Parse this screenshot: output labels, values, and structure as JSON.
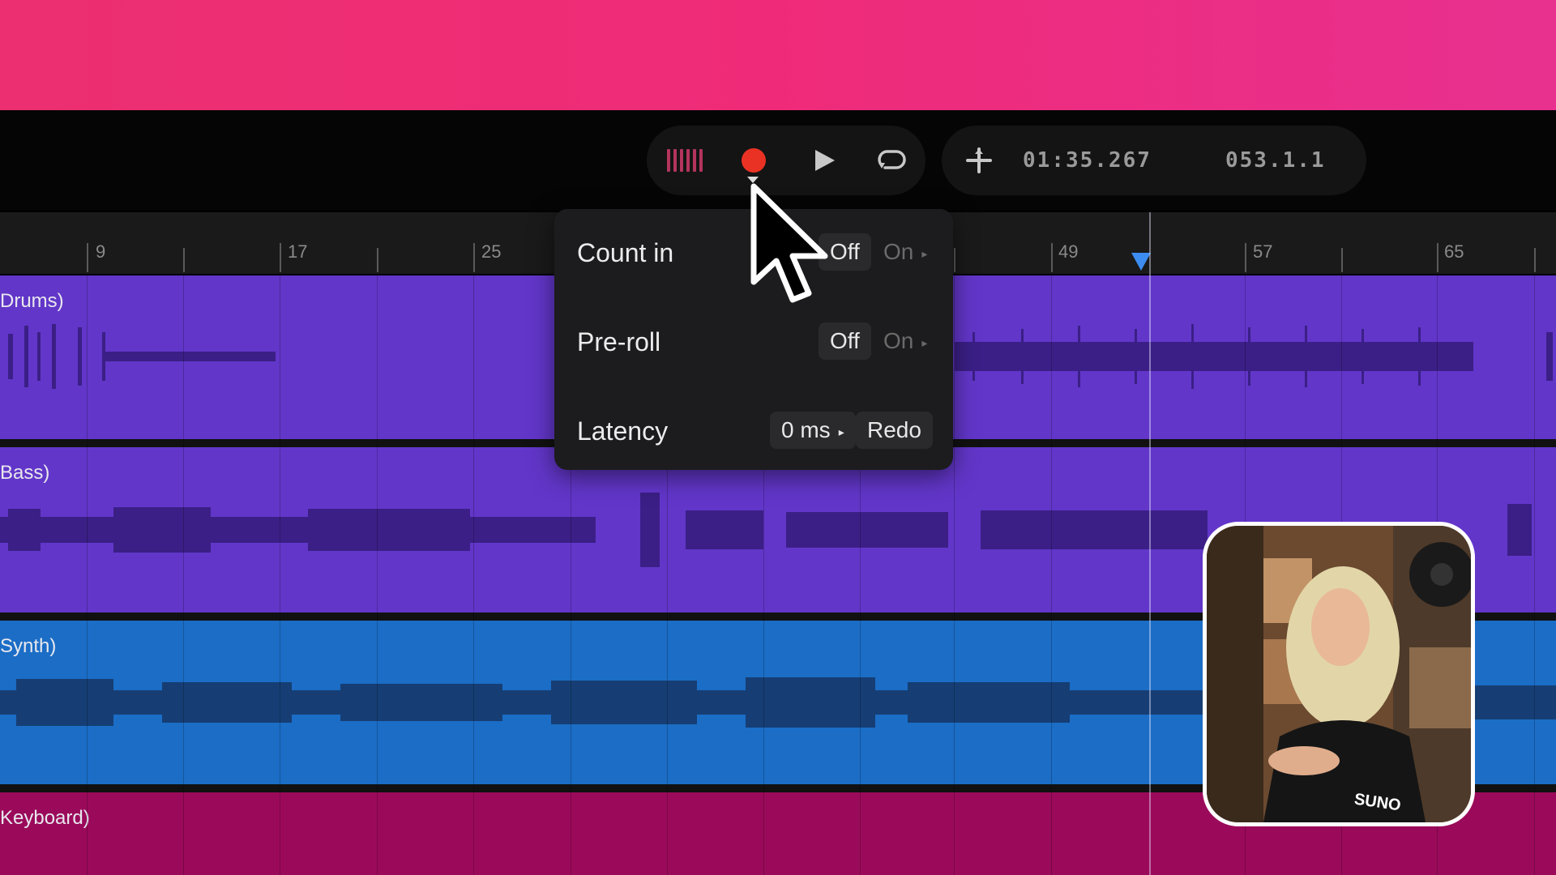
{
  "transport": {
    "time": "01:35.267",
    "bars": "053.1.1"
  },
  "ruler": {
    "labels": [
      "9",
      "17",
      "25",
      "49",
      "57",
      "65"
    ]
  },
  "tracks": [
    {
      "name": "Drums)",
      "color": "#6236c9"
    },
    {
      "name": "Bass)",
      "color": "#6236c9"
    },
    {
      "name": "Synth)",
      "color": "#1b6dc6"
    },
    {
      "name": "Keyboard)",
      "color": "#9b0a5a"
    }
  ],
  "popup": {
    "count_in": {
      "label": "Count in",
      "off": "Off",
      "on": "On"
    },
    "pre_roll": {
      "label": "Pre-roll",
      "off": "Off",
      "on": "On"
    },
    "latency": {
      "label": "Latency",
      "value": "0 ms",
      "redo": "Redo"
    }
  },
  "webcam": {
    "shirt_text": "SUNO"
  },
  "colors": {
    "accent_record": "#ea3224",
    "playhead": "#3d8cf0",
    "header_pink": "#ec2f70"
  }
}
